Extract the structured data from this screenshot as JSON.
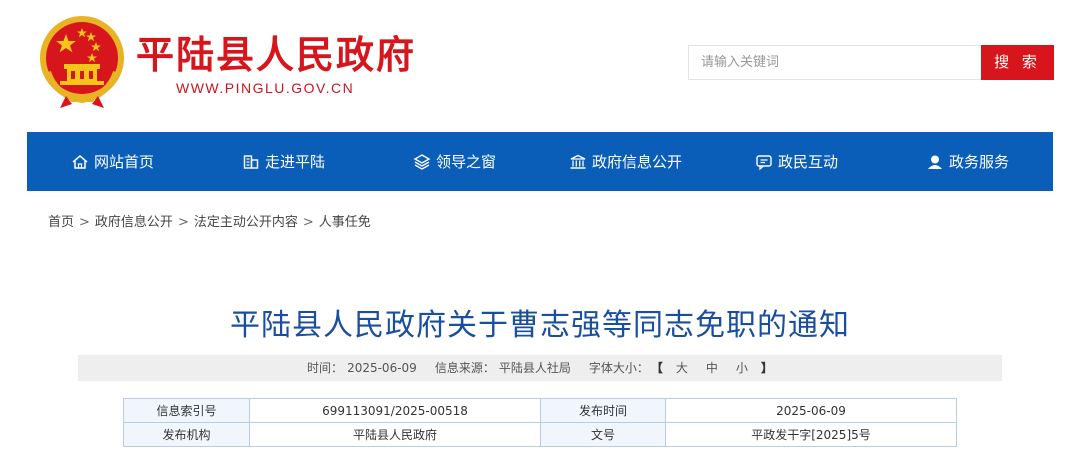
{
  "header": {
    "site_title": "平陆县人民政府",
    "site_url": "WWW.PINGLU.GOV.CN",
    "logo_icon": "national-emblem-icon"
  },
  "search": {
    "placeholder": "请输入关键词",
    "button_label": "搜 索"
  },
  "nav": {
    "items": [
      {
        "label": "网站首页",
        "icon": "home-icon"
      },
      {
        "label": "走进平陆",
        "icon": "building-icon"
      },
      {
        "label": "领导之窗",
        "icon": "layers-icon"
      },
      {
        "label": "政府信息公开",
        "icon": "government-icon"
      },
      {
        "label": "政民互动",
        "icon": "chat-icon"
      },
      {
        "label": "政务服务",
        "icon": "user-service-icon"
      }
    ]
  },
  "breadcrumb": {
    "items": [
      "首页",
      "政府信息公开",
      "法定主动公开内容",
      "人事任免"
    ],
    "separator": ">"
  },
  "article": {
    "title": "平陆县人民政府关于曹志强等同志免职的通知",
    "meta": {
      "time_label": "时间：",
      "time": "2025-06-09",
      "source_label": "信息来源：",
      "source": "平陆县人社局",
      "font_label": "字体大小：",
      "bracket_open": "【",
      "font_large": "大",
      "font_medium": "中",
      "font_small": "小",
      "bracket_close": "】"
    },
    "info_table": {
      "index_label": "信息索引号",
      "index_value": "699113091/2025-00518",
      "publish_time_label": "发布时间",
      "publish_time_value": "2025-06-09",
      "publisher_label": "发布机构",
      "publisher_value": "平陆县人民政府",
      "doc_no_label": "文号",
      "doc_no_value": "平政发干字[2025]5号"
    }
  },
  "colors": {
    "brand_red": "#d6161c",
    "nav_blue": "#0a5eb8",
    "title_blue": "#1a4e9e"
  }
}
